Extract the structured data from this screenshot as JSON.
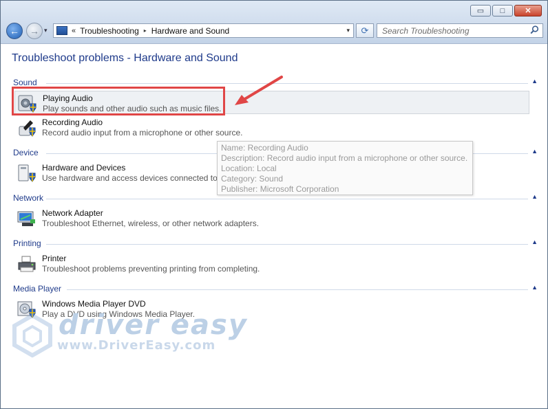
{
  "window": {
    "minimize_glyph": "▭",
    "maximize_glyph": "□",
    "close_glyph": "✕"
  },
  "nav": {
    "recent_glyph": "▾",
    "overflow_glyph": "«",
    "crumbs": [
      "Troubleshooting",
      "Hardware and Sound"
    ],
    "crumb_sep_glyph": "▸",
    "dropdown_glyph": "▾",
    "refresh_glyph": "⟳"
  },
  "search": {
    "placeholder": "Search Troubleshooting",
    "icon": "search-icon"
  },
  "page": {
    "title": "Troubleshoot problems - Hardware and Sound"
  },
  "groups": [
    {
      "name": "Sound",
      "items": [
        {
          "title": "Playing Audio",
          "desc": "Play sounds and other audio such as music files.",
          "icon": "speaker-icon",
          "highlighted": true
        },
        {
          "title": "Recording Audio",
          "desc": "Record audio input from a microphone or other source.",
          "icon": "microphone-icon"
        }
      ]
    },
    {
      "name": "Device",
      "items": [
        {
          "title": "Hardware and Devices",
          "desc": "Use hardware and access devices connected to your computer.",
          "icon": "hardware-icon"
        }
      ]
    },
    {
      "name": "Network",
      "items": [
        {
          "title": "Network Adapter",
          "desc": "Troubleshoot Ethernet, wireless, or other network adapters.",
          "icon": "network-adapter-icon"
        }
      ]
    },
    {
      "name": "Printing",
      "items": [
        {
          "title": "Printer",
          "desc": "Troubleshoot problems preventing printing from completing.",
          "icon": "printer-icon"
        }
      ]
    },
    {
      "name": "Media Player",
      "items": [
        {
          "title": "Windows Media Player DVD",
          "desc": "Play a DVD using Windows Media Player.",
          "icon": "dvd-icon"
        }
      ]
    }
  ],
  "collapse_glyph": "▲",
  "tooltip": {
    "lines": [
      "Name: Recording Audio",
      "Description: Record audio input from a microphone or other source.",
      "Location: Local",
      "Category: Sound",
      "Publisher: Microsoft Corporation"
    ]
  },
  "watermark": {
    "brand": "driver easy",
    "url": "www.DriverEasy.com"
  },
  "colors": {
    "heading": "#1e3a8a",
    "annotation": "#e04646"
  }
}
